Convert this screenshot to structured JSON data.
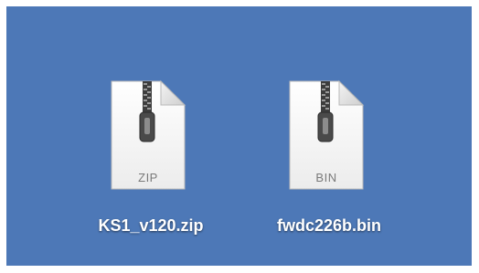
{
  "desktop": {
    "background_color": "#4d78b7",
    "files": [
      {
        "name": "KS1_v120.zip",
        "extension_label": "ZIP",
        "icon": "zip-archive-icon"
      },
      {
        "name": "fwdc226b.bin",
        "extension_label": "BIN",
        "icon": "bin-archive-icon"
      }
    ]
  }
}
